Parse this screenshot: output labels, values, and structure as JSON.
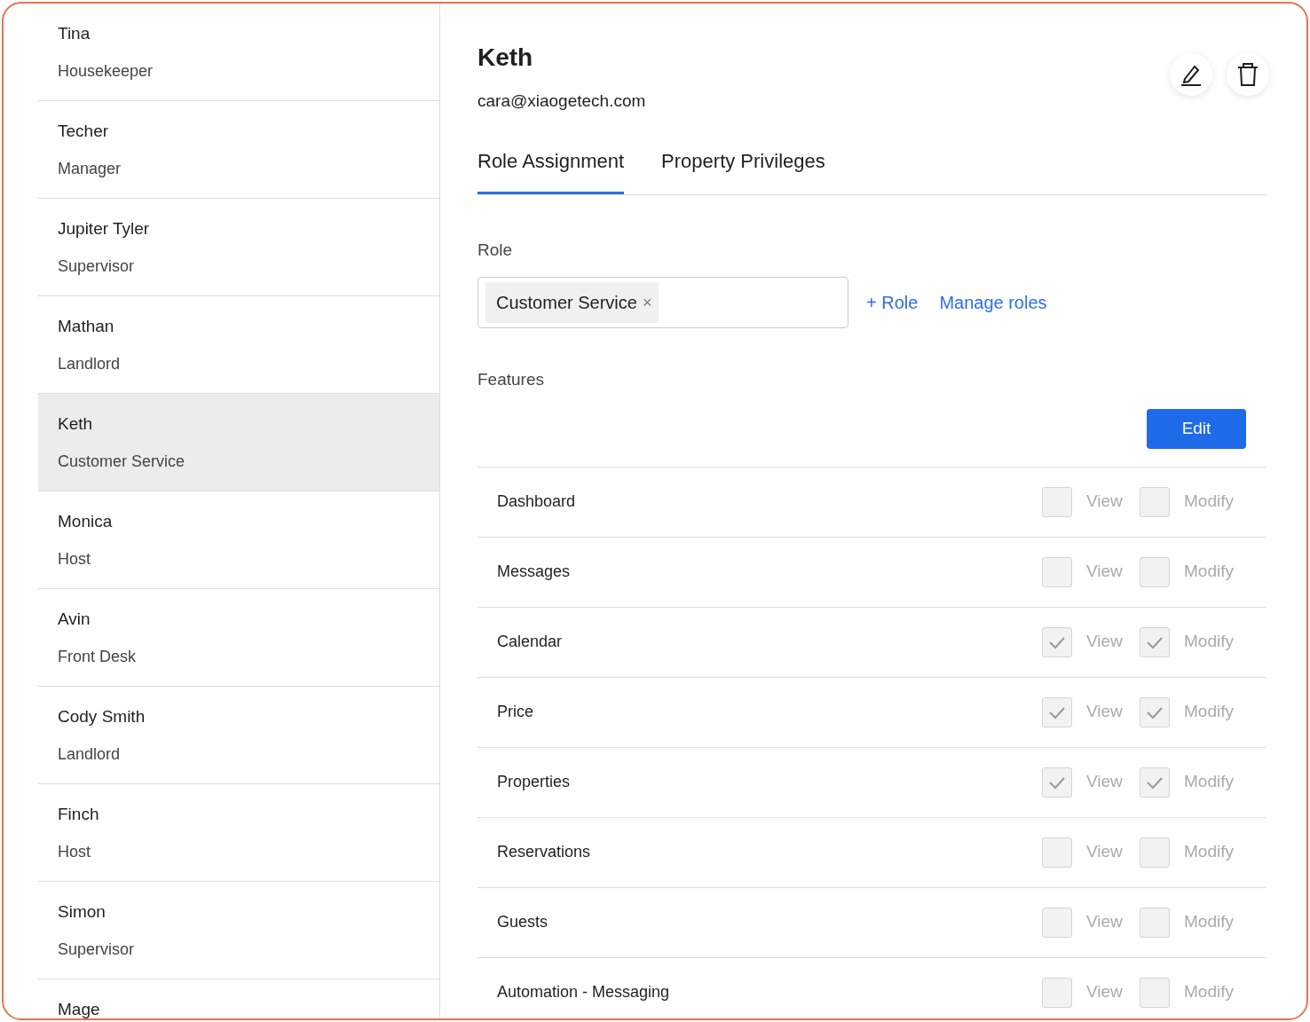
{
  "users": [
    {
      "name": "Tina",
      "role": "Housekeeper",
      "selected": false
    },
    {
      "name": "Techer",
      "role": "Manager",
      "selected": false
    },
    {
      "name": "Jupiter Tyler",
      "role": "Supervisor",
      "selected": false
    },
    {
      "name": "Mathan",
      "role": "Landlord",
      "selected": false
    },
    {
      "name": "Keth",
      "role": "Customer Service",
      "selected": true
    },
    {
      "name": "Monica",
      "role": "Host",
      "selected": false
    },
    {
      "name": "Avin",
      "role": "Front Desk",
      "selected": false
    },
    {
      "name": "Cody Smith",
      "role": "Landlord",
      "selected": false
    },
    {
      "name": "Finch",
      "role": "Host",
      "selected": false
    },
    {
      "name": "Simon",
      "role": "Supervisor",
      "selected": false
    },
    {
      "name": "Mage"
    }
  ],
  "detail": {
    "name": "Keth",
    "email": "cara@xiaogetech.com"
  },
  "tabs": [
    {
      "label": "Role Assignment",
      "selected": true
    },
    {
      "label": "Property Privileges",
      "selected": false
    }
  ],
  "role_label": "Role",
  "roles": [
    {
      "label": "Customer Service",
      "remove": "×"
    }
  ],
  "add_role": "+ Role",
  "manage_roles": "Manage roles",
  "features_label": "Features",
  "edit_button": "Edit",
  "features": [
    {
      "name": "Dashboard",
      "view": {
        "label": "View",
        "checked": false,
        "disabled": true
      },
      "modify": {
        "label": "Modify",
        "checked": false,
        "disabled": true
      }
    },
    {
      "name": "Messages",
      "view": {
        "label": "View",
        "checked": false,
        "disabled": true
      },
      "modify": {
        "label": "Modify",
        "checked": false,
        "disabled": true
      }
    },
    {
      "name": "Calendar",
      "view": {
        "label": "View",
        "checked": true,
        "disabled": true
      },
      "modify": {
        "label": "Modify",
        "checked": true,
        "disabled": true
      }
    },
    {
      "name": "Price",
      "view": {
        "label": "View",
        "checked": true,
        "disabled": true
      },
      "modify": {
        "label": "Modify",
        "checked": true,
        "disabled": true
      }
    },
    {
      "name": "Properties",
      "view": {
        "label": "View",
        "checked": true,
        "disabled": true
      },
      "modify": {
        "label": "Modify",
        "checked": true,
        "disabled": true
      }
    },
    {
      "name": "Reservations",
      "view": {
        "label": "View",
        "checked": false,
        "disabled": true
      },
      "modify": {
        "label": "Modify",
        "checked": false,
        "disabled": true
      }
    },
    {
      "name": "Guests",
      "view": {
        "label": "View",
        "checked": false,
        "disabled": true
      },
      "modify": {
        "label": "Modify",
        "checked": false,
        "disabled": true
      }
    },
    {
      "name": "Automation - Messaging",
      "view": {
        "label": "View",
        "checked": false,
        "disabled": true
      },
      "modify": {
        "label": "Modify",
        "checked": false,
        "disabled": true
      }
    }
  ]
}
